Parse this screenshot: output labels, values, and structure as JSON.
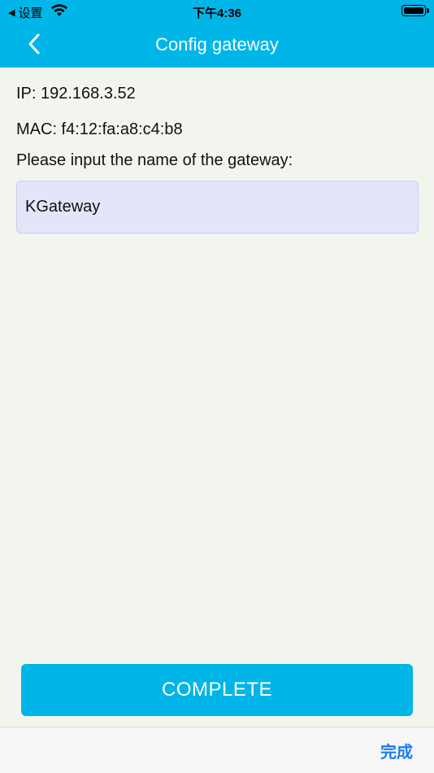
{
  "status_bar": {
    "back_app_label": "设置",
    "back_arrow": "◀",
    "time": "下午4:36"
  },
  "nav": {
    "title": "Config gateway",
    "back_icon": "chevron-left-icon"
  },
  "info": {
    "ip": "IP: 192.168.3.52",
    "mac": "MAC: f4:12:fa:a8:c4:b8",
    "prompt": "Please input the name of the gateway:"
  },
  "gateway_name": {
    "value": "KGateway"
  },
  "actions": {
    "complete_label": "COMPLETE",
    "done_label": "完成"
  },
  "colors": {
    "accent": "#00b5e8",
    "background": "#f2f5ee",
    "input_bg": "#e3e6fb",
    "done_blue": "#1a7cf5"
  }
}
